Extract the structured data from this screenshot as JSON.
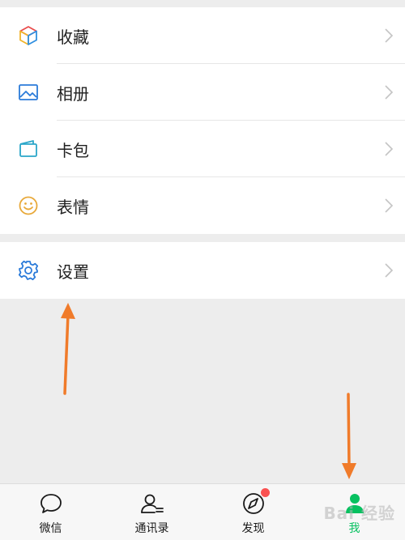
{
  "menu": {
    "groups": [
      {
        "items": [
          {
            "label": "收藏",
            "icon": "favorites-cube-icon"
          },
          {
            "label": "相册",
            "icon": "album-photo-icon"
          },
          {
            "label": "卡包",
            "icon": "card-wallet-icon"
          },
          {
            "label": "表情",
            "icon": "sticker-smiley-icon"
          }
        ]
      },
      {
        "items": [
          {
            "label": "设置",
            "icon": "settings-gear-icon"
          }
        ]
      }
    ]
  },
  "tabbar": {
    "tabs": [
      {
        "label": "微信",
        "icon": "chat-bubble-icon"
      },
      {
        "label": "通讯录",
        "icon": "contacts-icon"
      },
      {
        "label": "发现",
        "icon": "discover-compass-icon",
        "badge": "dot"
      },
      {
        "label": "我",
        "icon": "me-person-icon",
        "active": true
      }
    ]
  },
  "watermark": {
    "text": "Bai 经验"
  },
  "colors": {
    "active": "#07c160",
    "annotation_arrow": "#f07b2a",
    "badge": "#fa5151",
    "background": "#ededed"
  }
}
